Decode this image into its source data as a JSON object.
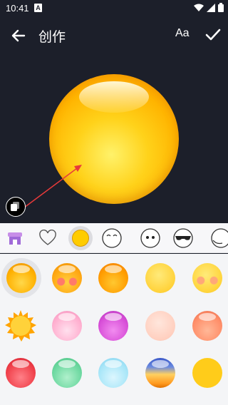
{
  "status": {
    "time": "10:41",
    "app_badge": "A"
  },
  "toolbar": {
    "title": "创作",
    "font_label": "Aa"
  },
  "tabs": [
    {
      "name": "tab-sticker-store",
      "icon": "store-icon"
    },
    {
      "name": "tab-favorites",
      "icon": "heart-icon"
    },
    {
      "name": "tab-base",
      "icon": "yellow-circle-icon"
    },
    {
      "name": "tab-eyes-closed",
      "icon": "smile-eyes-icon"
    },
    {
      "name": "tab-eyes-dots",
      "icon": "dot-eyes-icon"
    },
    {
      "name": "tab-sunglasses",
      "icon": "sunglasses-icon"
    },
    {
      "name": "tab-more",
      "icon": "partial-face-icon"
    }
  ],
  "base_colors": [
    "#ffb800",
    "#ffa814",
    "#ff9c00",
    "#ffd23a",
    "#ffd43a",
    "sun",
    "#ffb0d0",
    "#d84fd8",
    "#ffcfbf",
    "#ff8f6a",
    "#f0404a",
    "#6cd8a0",
    "#a8e6f8",
    "gradient-sunset",
    "#ffcc1a"
  ],
  "accent": "#ffc400"
}
